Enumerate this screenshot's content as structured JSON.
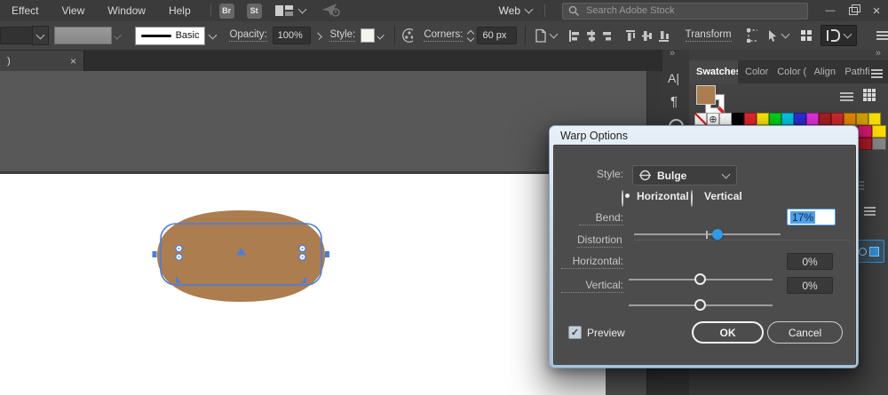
{
  "menu_bar": {
    "items": [
      {
        "label": "Effect"
      },
      {
        "label": "View"
      },
      {
        "label": "Window"
      },
      {
        "label": "Help"
      }
    ],
    "badge_br": "Br",
    "badge_st": "St",
    "workspace_label": "Web",
    "search_placeholder": "Search Adobe Stock"
  },
  "control_bar": {
    "brush_name": "Basic",
    "opacity_label": "Opacity:",
    "opacity_value": "100%",
    "style_label": "Style:",
    "corners_label": "Corners:",
    "corners_value": "60 px",
    "transform_label": "Transform"
  },
  "document_tab": {
    "label": ")"
  },
  "dock": {
    "tabs": [
      {
        "label": "Swatches",
        "active": true
      },
      {
        "label": "Color",
        "active": false
      },
      {
        "label": "Color (",
        "active": false
      },
      {
        "label": "Align",
        "active": false
      },
      {
        "label": "Pathfi",
        "active": false
      }
    ],
    "fill_color": "#ab7d4f",
    "swatches": [
      {
        "name": "none"
      },
      {
        "name": "registration"
      },
      {
        "name": "white",
        "hex": "#ffffff"
      },
      {
        "name": "black",
        "hex": "#000000"
      },
      {
        "name": "red",
        "hex": "#e8262d"
      },
      {
        "name": "yellow",
        "hex": "#ffe800"
      },
      {
        "name": "green",
        "hex": "#00d41d"
      },
      {
        "name": "cyan",
        "hex": "#00c9e8"
      },
      {
        "name": "blue",
        "hex": "#2b2fd9"
      },
      {
        "name": "magenta",
        "hex": "#e431e0"
      },
      {
        "name": "dark-red",
        "hex": "#ad1e23"
      },
      {
        "name": "crimson",
        "hex": "#cf2a2f"
      },
      {
        "name": "orange",
        "hex": "#e28800"
      },
      {
        "name": "amber",
        "hex": "#d29e00"
      },
      {
        "name": "bright-yellow",
        "hex": "#f8e000"
      }
    ],
    "partial_swatches": [
      {
        "name": "pink",
        "hex": "#d6186e"
      },
      {
        "name": "yellow2",
        "hex": "#ffdf00"
      },
      {
        "name": "red2",
        "hex": "#b01c24"
      }
    ]
  },
  "dialog": {
    "title": "Warp Options",
    "style_label": "Style:",
    "style_value": "Bulge",
    "horizontal_radio_label": "Horizontal",
    "vertical_radio_label": "Vertical",
    "bend_label": "Bend:",
    "bend_value": "17%",
    "distortion_label": "Distortion",
    "distortion_horizontal_label": "Horizontal:",
    "distortion_horizontal_value": "0%",
    "distortion_vertical_label": "Vertical:",
    "distortion_vertical_value": "0%",
    "preview_label": "Preview",
    "ok_label": "OK",
    "cancel_label": "Cancel"
  },
  "canvas": {
    "shape_fill": "#ab7d4f",
    "selection_color": "#4a7de0"
  },
  "icons": {
    "close": "×",
    "minimize": "—",
    "collapse": "»",
    "character": "A|",
    "paragraph": "¶",
    "registration": "⊕",
    "check": "✓"
  }
}
